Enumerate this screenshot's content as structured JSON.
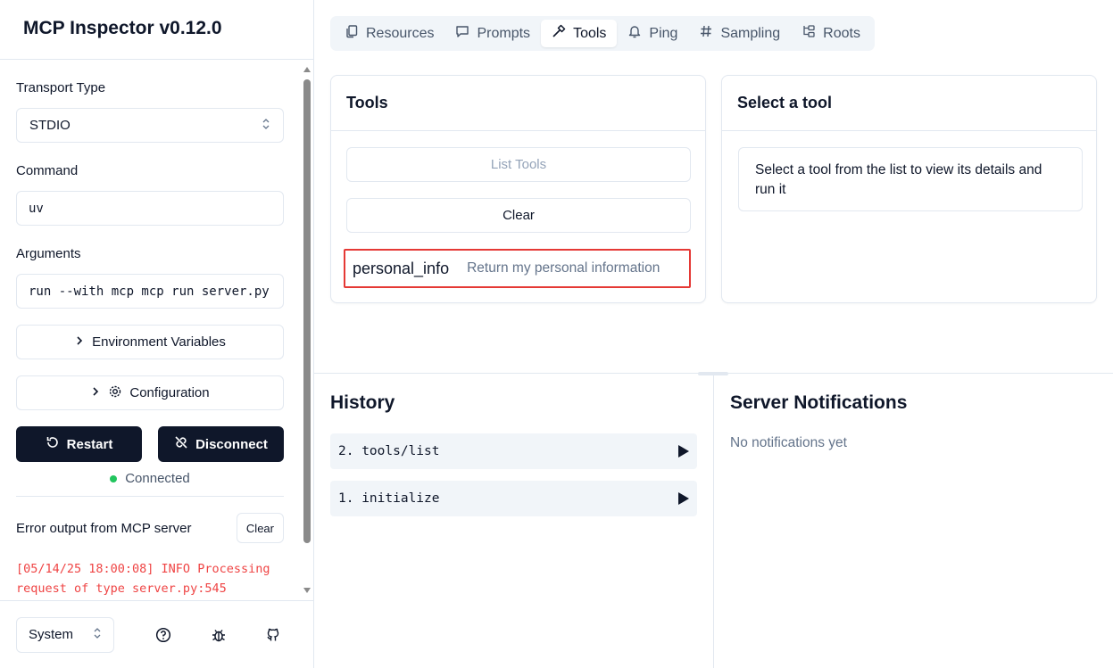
{
  "app": {
    "title": "MCP Inspector v0.12.0"
  },
  "sidebar": {
    "transport": {
      "label": "Transport Type",
      "value": "STDIO"
    },
    "command": {
      "label": "Command",
      "value": "uv"
    },
    "arguments": {
      "label": "Arguments",
      "value": "run --with mcp mcp run server.py"
    },
    "env_button": "Environment Variables",
    "config_button": "Configuration",
    "restart_button": "Restart",
    "disconnect_button": "Disconnect",
    "status": "Connected",
    "status_color": "#22c55e",
    "error_output": {
      "label": "Error output from MCP server",
      "clear": "Clear",
      "lines": [
        "[05/14/25 18:00:08] INFO Processing",
        "request of type server.py:545"
      ]
    },
    "footer": {
      "theme": "System",
      "icons": [
        "help-icon",
        "bug-icon",
        "github-icon"
      ]
    }
  },
  "tabs": [
    {
      "label": "Resources",
      "icon": "files-icon"
    },
    {
      "label": "Prompts",
      "icon": "message-icon"
    },
    {
      "label": "Tools",
      "icon": "hammer-icon",
      "active": true
    },
    {
      "label": "Ping",
      "icon": "bell-icon"
    },
    {
      "label": "Sampling",
      "icon": "hash-icon"
    },
    {
      "label": "Roots",
      "icon": "folder-tree-icon"
    }
  ],
  "tools_panel": {
    "title": "Tools",
    "list_button": "List Tools",
    "clear_button": "Clear",
    "items": [
      {
        "name": "personal_info",
        "description": "Return my personal information"
      }
    ]
  },
  "detail_panel": {
    "title": "Select a tool",
    "message": "Select a tool from the list to view its details and run it"
  },
  "history": {
    "title": "History",
    "items": [
      "2. tools/list",
      "1. initialize"
    ]
  },
  "notifications": {
    "title": "Server Notifications",
    "empty": "No notifications yet"
  },
  "colors": {
    "accent_dark": "#0f172a",
    "highlight_border": "#e53935",
    "error_text": "#ef4444"
  }
}
